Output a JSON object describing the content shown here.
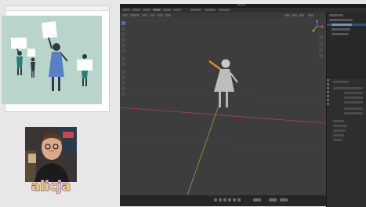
{
  "reference_image": {
    "background": "#ffffff",
    "scene_bg": "#b8d4c9",
    "figure_colors": {
      "skin": "#2f3b44",
      "dress": "#5b7fc4",
      "sign": "#ffffff",
      "teal": "#2a7d7a"
    }
  },
  "webcam": {
    "sticker_text": "alicja",
    "sticker_colors": {
      "fill": "#f4d35e",
      "outline": "#7b4fd1"
    }
  },
  "blender": {
    "window_title": "Blender",
    "accent": "#4772b3",
    "viewport_bg": "#3d3d3d",
    "model": {
      "body_color": "#bdbdbd",
      "arm_color": "#e08a2a"
    },
    "axes": {
      "x_color": "#b0433f",
      "y_color": "#8aa43a"
    }
  }
}
